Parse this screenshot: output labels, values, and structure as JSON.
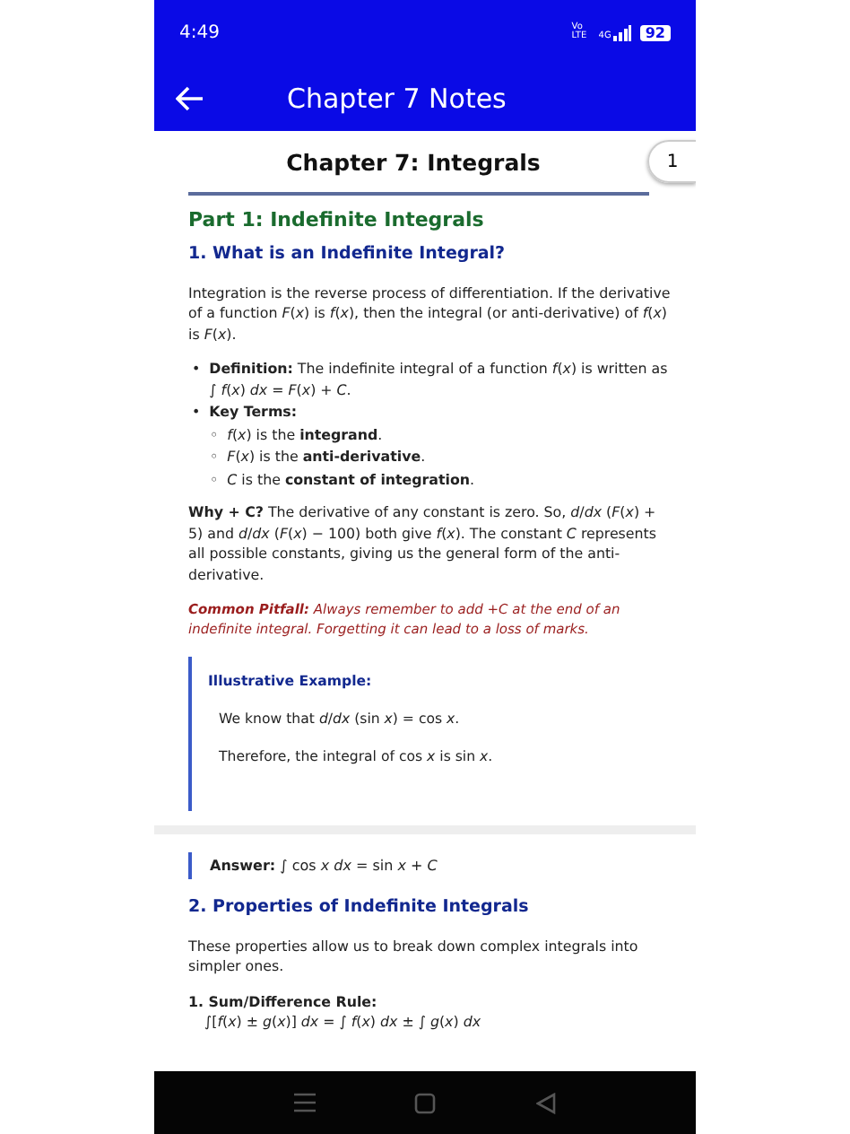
{
  "status_bar": {
    "time": "4:49",
    "volte": "Vo LTE",
    "network": "4G",
    "battery": "92"
  },
  "app_bar": {
    "title": "Chapter 7 Notes"
  },
  "page": {
    "title": "Chapter 7: Integrals",
    "page_number": "1"
  },
  "blocks": [
    {
      "kind": "part",
      "text": "Part 1: Indefinite Integrals"
    },
    {
      "kind": "section",
      "text": "1. What is an Indefinite Integral?"
    },
    {
      "kind": "para",
      "text": "Integration is the reverse process of differentiation. If the derivative of a function *F*(*x*) is *f*(*x*), then the integral (or anti-derivative) of *f*(*x*) is *F*(*x*)."
    },
    {
      "kind": "bullets",
      "items": [
        {
          "marker": "•",
          "text": "**Definition:** The indefinite integral of a function *f*(*x*) is written as ∫ *f*(*x*) *dx* = *F*(*x*) + *C*."
        },
        {
          "marker": "•",
          "text": "**Key Terms:**",
          "children": [
            {
              "marker": "◦",
              "text": "*f*(*x*) is the **integrand**."
            },
            {
              "marker": "◦",
              "text": "*F*(*x*) is the **anti-derivative**."
            },
            {
              "marker": "◦",
              "text": "*C* is the **constant of integration**."
            }
          ]
        }
      ]
    },
    {
      "kind": "para",
      "text": "**Why + C?** The derivative of any constant is zero. So, *d*/*dx* (*F*(*x*) + 5) and *d*/*dx* (*F*(*x*) − 100) both give *f*(*x*). The constant *C* represents all possible constants, giving us the general form of the anti-derivative."
    },
    {
      "kind": "pitfall",
      "text": "**Common Pitfall:** Always remember to add +*C* at the end of an indefinite integral. Forgetting it can lead to a loss of marks."
    },
    {
      "kind": "example",
      "title": "Illustrative Example:",
      "lines": [
        "We know that *d*/*dx* (sin *x*) = cos *x*.",
        "Therefore, the integral of cos *x* is sin *x*."
      ]
    },
    {
      "kind": "page_break"
    },
    {
      "kind": "answer",
      "text": "**Answer:** ∫ cos *x dx* = sin *x* + *C*"
    },
    {
      "kind": "section",
      "text": "2. Properties of Indefinite Integrals"
    },
    {
      "kind": "para",
      "text": "These properties allow us to break down complex integrals into simpler ones."
    },
    {
      "kind": "numbered",
      "items": [
        {
          "title": "1. Sum/Difference Rule:",
          "formula": "∫[*f*(*x*) ± *g*(*x*)] *dx* = ∫ *f*(*x*) *dx* ± ∫ *g*(*x*) *dx*"
        }
      ]
    }
  ]
}
